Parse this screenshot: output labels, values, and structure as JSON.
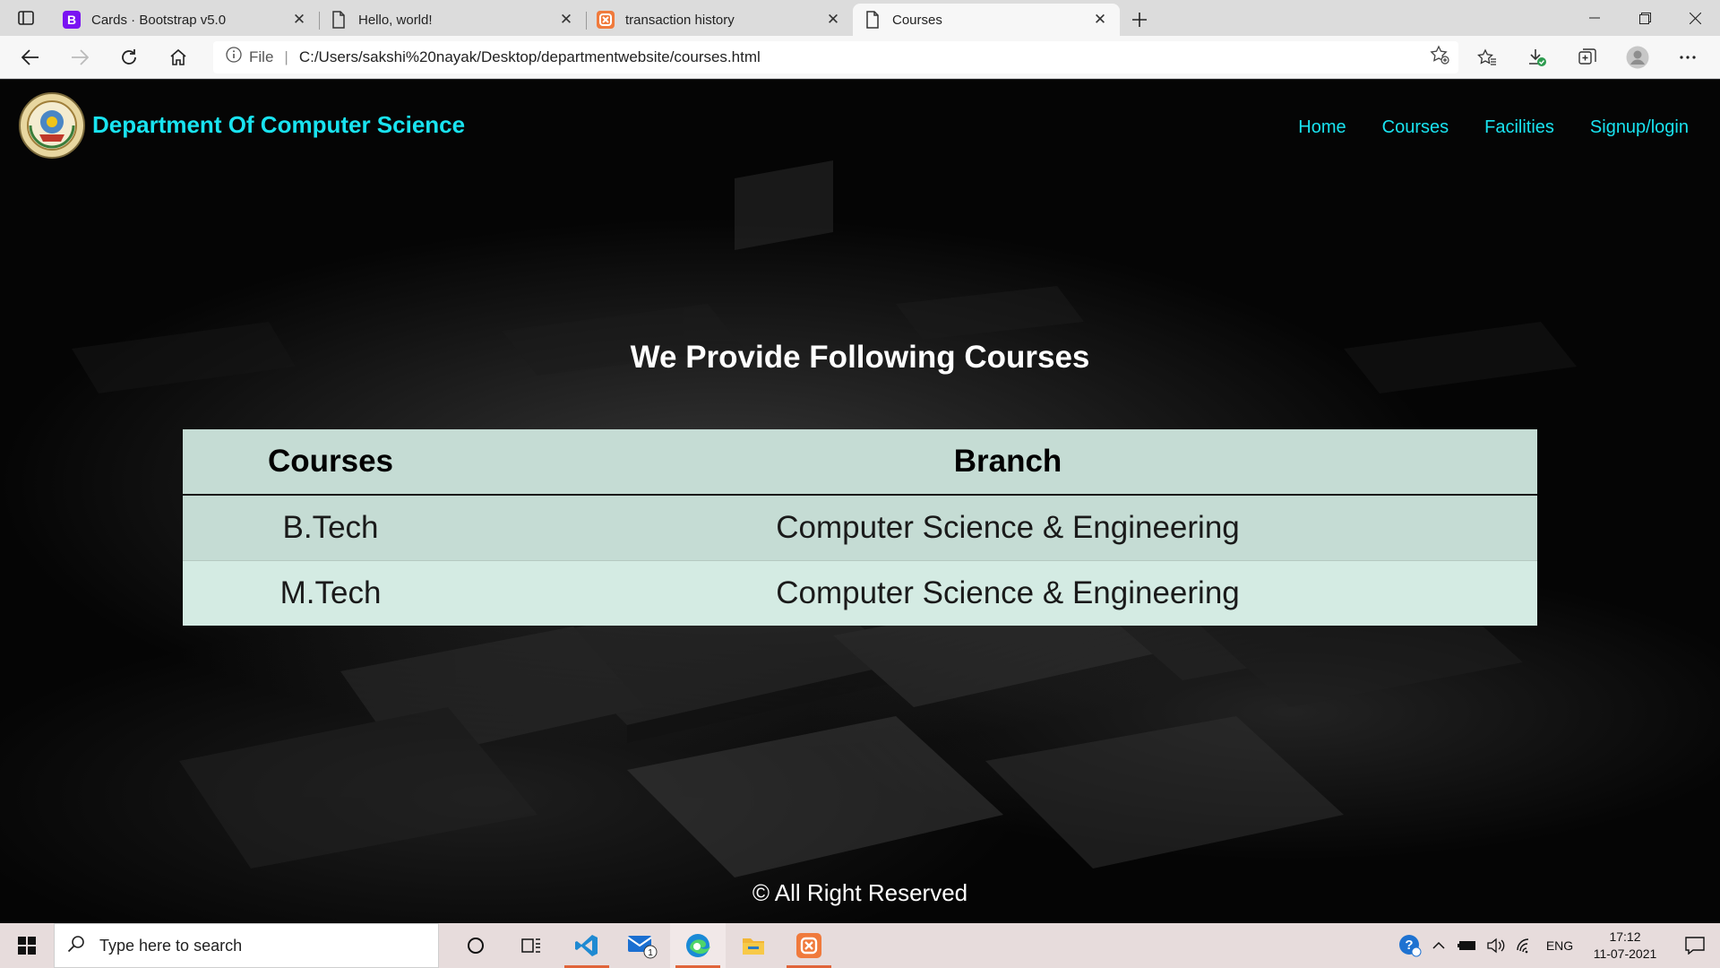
{
  "browser": {
    "tabs": [
      {
        "title": "Cards · Bootstrap v5.0",
        "icon": "bootstrap-icon",
        "active": false
      },
      {
        "title": "Hello, world!",
        "icon": "page-icon",
        "active": false
      },
      {
        "title": "transaction history",
        "icon": "xampp-icon",
        "active": false
      },
      {
        "title": "Courses",
        "icon": "page-icon",
        "active": true
      }
    ],
    "address": {
      "scheme_label": "File",
      "url": "C:/Users/sakshi%20nayak/Desktop/departmentwebsite/courses.html"
    }
  },
  "site": {
    "brand": "Department Of Computer Science",
    "nav": [
      "Home",
      "Courses",
      "Facilities",
      "Signup/login"
    ],
    "heading": "We Provide Following Courses",
    "table": {
      "headers": [
        "Courses",
        "Branch"
      ],
      "rows": [
        [
          "B.Tech",
          "Computer Science & Engineering"
        ],
        [
          "M.Tech",
          "Computer Science & Engineering"
        ]
      ]
    },
    "footer": "© All Right Reserved"
  },
  "taskbar": {
    "search_placeholder": "Type here to search",
    "mail_badge": "1",
    "language": "ENG",
    "time": "17:12",
    "date": "11-07-2021"
  },
  "colors": {
    "brand_text": "#19e3f0",
    "table_header_bg": "#c5dcd4",
    "table_alt_row_bg": "#d4ebe3",
    "taskbar_bg": "#e7dcdc"
  }
}
